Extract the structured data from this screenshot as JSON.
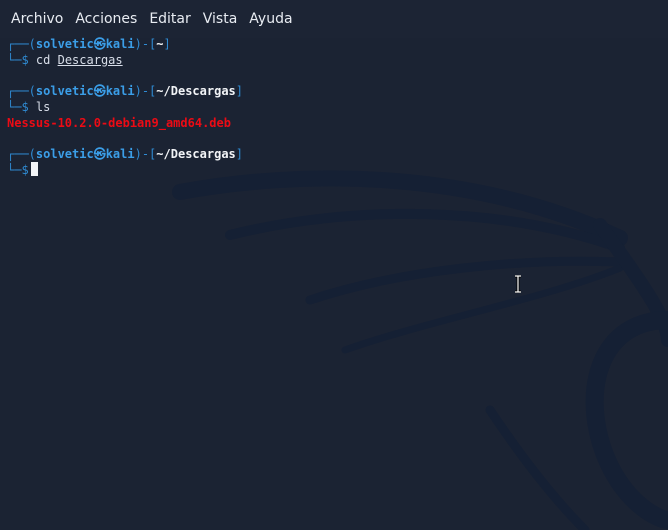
{
  "menubar": {
    "items": [
      "Archivo",
      "Acciones",
      "Editar",
      "Vista",
      "Ayuda"
    ]
  },
  "terminal": {
    "prompt_user": "solvetic㉿kali",
    "blocks": [
      {
        "path": "~",
        "command": "cd",
        "argument": "Descargas",
        "output": ""
      },
      {
        "path": "~/Descargas",
        "command": "ls",
        "argument": "",
        "output": "Nessus-10.2.0-debian9_amd64.deb"
      },
      {
        "path": "~/Descargas",
        "command": "",
        "argument": "",
        "output": ""
      }
    ]
  },
  "colors": {
    "background": "#1b2333",
    "prompt_bracket": "#2f8bd3",
    "prompt_user": "#3b9ee8",
    "error_output": "#ec0b15"
  }
}
